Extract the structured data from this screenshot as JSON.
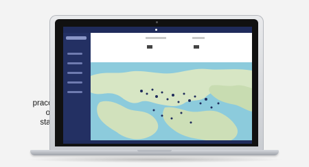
{
  "caption": {
    "lines": [
      "pracovišť,",
      "obální",
      "stalace."
    ]
  }
}
